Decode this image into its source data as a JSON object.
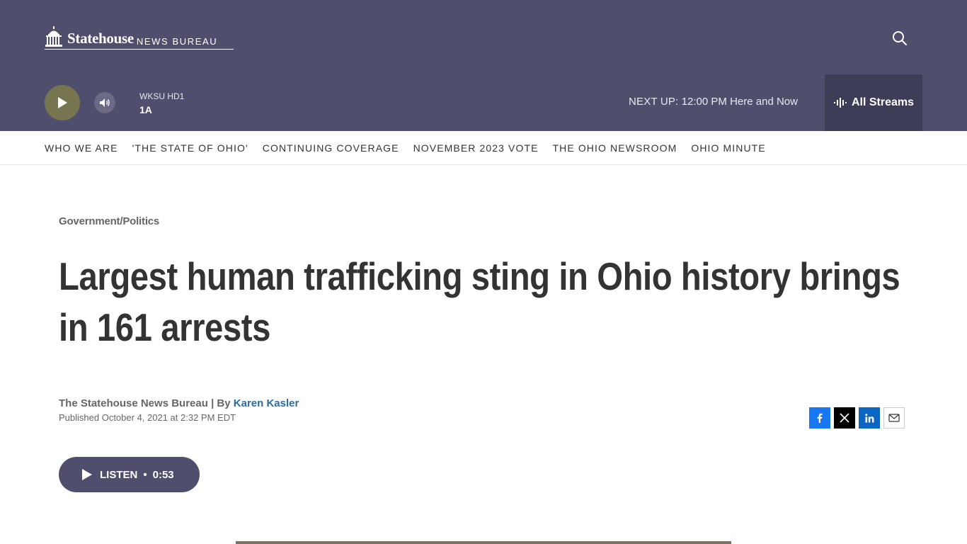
{
  "brand": {
    "logo_main": "Statehouse",
    "logo_sub": "NEWS BUREAU"
  },
  "player": {
    "station_name": "WKSU HD1",
    "show_name": "1A",
    "next_up_label": "NEXT UP:",
    "next_up_time": "12:00 PM",
    "next_up_show": "Here and Now",
    "all_streams_label": "All Streams"
  },
  "nav": {
    "items": [
      {
        "label": "WHO WE ARE"
      },
      {
        "label": "'THE STATE OF OHIO'"
      },
      {
        "label": "CONTINUING COVERAGE"
      },
      {
        "label": "NOVEMBER 2023 VOTE"
      },
      {
        "label": "THE OHIO NEWSROOM"
      },
      {
        "label": "OHIO MINUTE"
      }
    ]
  },
  "article": {
    "category": "Government/Politics",
    "headline": "Largest human trafficking sting in Ohio history brings in 161 arrests",
    "source": "The Statehouse News Bureau",
    "by_prefix": "| By",
    "author": "Karen Kasler",
    "published": "Published October 4, 2021 at 2:32 PM EDT",
    "listen_label": "LISTEN",
    "listen_separator": "•",
    "duration": "0:53"
  },
  "colors": {
    "header_bg": "#4f4e6c",
    "play_button": "#76754f",
    "link": "#2a6ba6",
    "facebook": "#1877f2",
    "x": "#000000",
    "linkedin": "#0a66c2"
  },
  "icons": {
    "search": "search-icon",
    "play": "play-icon",
    "volume": "volume-icon",
    "streams": "audio-wave-icon",
    "facebook": "facebook-icon",
    "x": "x-icon",
    "linkedin": "linkedin-icon",
    "email": "email-icon"
  }
}
